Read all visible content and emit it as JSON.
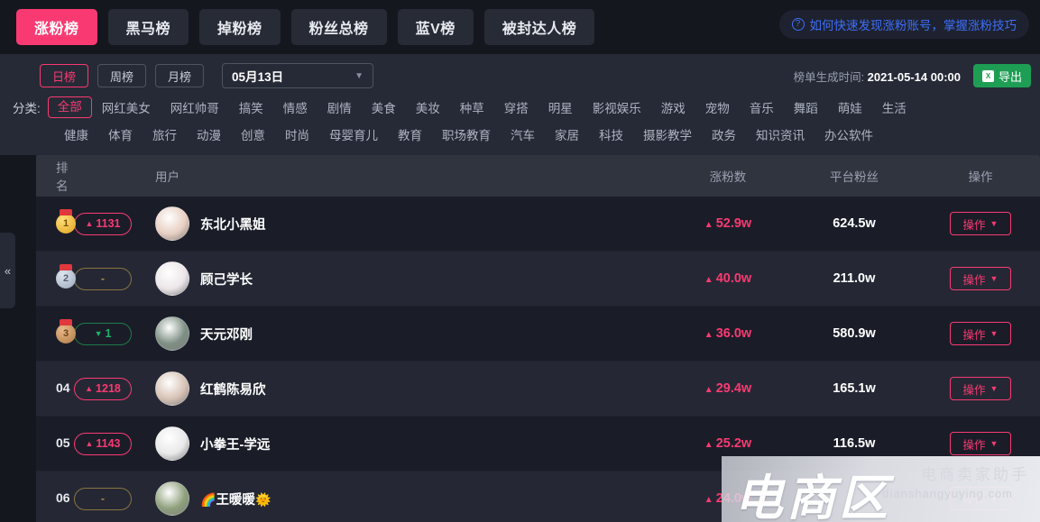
{
  "tabs": [
    {
      "label": "涨粉榜",
      "active": true
    },
    {
      "label": "黑马榜",
      "active": false
    },
    {
      "label": "掉粉榜",
      "active": false
    },
    {
      "label": "粉丝总榜",
      "active": false
    },
    {
      "label": "蓝V榜",
      "active": false
    },
    {
      "label": "被封达人榜",
      "active": false
    }
  ],
  "help": {
    "icon": "question-circle-icon",
    "text": "如何快速发现涨粉账号，掌握涨粉技巧"
  },
  "filters": {
    "period": [
      {
        "label": "日榜",
        "active": true
      },
      {
        "label": "周榜",
        "active": false
      },
      {
        "label": "月榜",
        "active": false
      }
    ],
    "date_value": "05月13日",
    "date_chevron": "▼",
    "generated_label": "榜单生成时间:",
    "generated_time": "2021-05-14 00:00",
    "export_label": "导出",
    "export_icon": "excel-icon",
    "export_icon_text": "X",
    "category_label": "分类:",
    "categories_row1": [
      "全部",
      "网红美女",
      "网红帅哥",
      "搞笑",
      "情感",
      "剧情",
      "美食",
      "美妆",
      "种草",
      "穿搭",
      "明星",
      "影视娱乐",
      "游戏",
      "宠物",
      "音乐",
      "舞蹈",
      "萌娃",
      "生活"
    ],
    "categories_row2": [
      "健康",
      "体育",
      "旅行",
      "动漫",
      "创意",
      "时尚",
      "母婴育儿",
      "教育",
      "职场教育",
      "汽车",
      "家居",
      "科技",
      "摄影教学",
      "政务",
      "知识资讯",
      "办公软件"
    ],
    "active_category": "全部"
  },
  "table": {
    "headers": {
      "rank": "排名",
      "user": "用户",
      "gain": "涨粉数",
      "fans": "平台粉丝",
      "action": "操作"
    },
    "action_label": "操作",
    "action_chevron": "▼",
    "rows": [
      {
        "rank": "1",
        "rank_type": "medal-gold",
        "delta": "1131",
        "delta_dir": "up",
        "delta_symbol": "▲",
        "name": "东北小黑姐",
        "name_prefix": "",
        "name_suffix": "",
        "avatar_color": "#e8cfc2",
        "gain": "52.9w",
        "gain_symbol": "▲",
        "fans": "624.5w"
      },
      {
        "rank": "2",
        "rank_type": "medal-silver",
        "delta": "-",
        "delta_dir": "flat",
        "delta_symbol": "",
        "name": "顾己学长",
        "name_prefix": "",
        "name_suffix": "",
        "avatar_color": "#ece6e9",
        "gain": "40.0w",
        "gain_symbol": "▲",
        "fans": "211.0w"
      },
      {
        "rank": "3",
        "rank_type": "medal-bronze",
        "delta": "1",
        "delta_dir": "down",
        "delta_symbol": "▼",
        "name": "天元邓刚",
        "name_prefix": "",
        "name_suffix": "",
        "avatar_color": "#7e8f84",
        "gain": "36.0w",
        "gain_symbol": "▲",
        "fans": "580.9w"
      },
      {
        "rank": "04",
        "rank_type": "number",
        "delta": "1218",
        "delta_dir": "up",
        "delta_symbol": "▲",
        "name": "红鹤陈易欣",
        "name_prefix": "",
        "name_suffix": "",
        "avatar_color": "#d8c3b6",
        "gain": "29.4w",
        "gain_symbol": "▲",
        "fans": "165.1w"
      },
      {
        "rank": "05",
        "rank_type": "number",
        "delta": "1143",
        "delta_dir": "up",
        "delta_symbol": "▲",
        "name": "小拳王-学远",
        "name_prefix": "",
        "name_suffix": "",
        "avatar_color": "#e9e9ea",
        "gain": "25.2w",
        "gain_symbol": "▲",
        "fans": "116.5w"
      },
      {
        "rank": "06",
        "rank_type": "number",
        "delta": "-",
        "delta_dir": "flat",
        "delta_symbol": "",
        "name": "王暖暖",
        "name_prefix": "🌈",
        "name_suffix": "🌞",
        "avatar_color": "#8fa07c",
        "gain": "24.0w",
        "gain_symbol": "▲",
        "fans": ""
      }
    ]
  },
  "collapse_handle": {
    "icon": "double-chevron-left-icon",
    "glyph": "«"
  },
  "watermark": {
    "big": "电商区",
    "sub": "电商卖家助手",
    "url": "dianshangyuying.com"
  },
  "colors": {
    "accent": "#f93a72",
    "link": "#3d6ef5",
    "export": "#1e9e54",
    "down": "#19b36b"
  }
}
